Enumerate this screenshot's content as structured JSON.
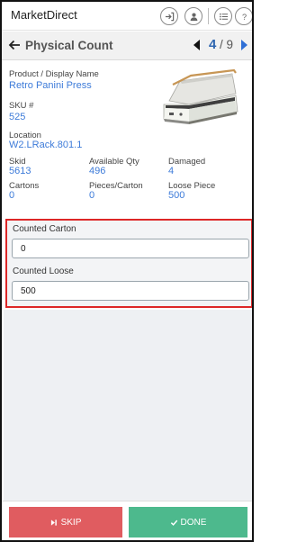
{
  "app": {
    "title": "MarketDirect"
  },
  "header": {
    "title": "Physical Count",
    "page_current": "4",
    "page_sep": "/ 9"
  },
  "details": {
    "product_label": "Product / Display Name",
    "product_value": "Retro Panini Press",
    "sku_label": "SKU #",
    "sku_value": "525",
    "location_label": "Location",
    "location_value": "W2.LRack.801.1",
    "skid_label": "Skid",
    "skid_value": "5613",
    "available_label": "Available Qty",
    "available_value": "496",
    "damaged_label": "Damaged",
    "damaged_value": "4",
    "cartons_label": "Cartons",
    "cartons_value": "0",
    "pieces_label": "Pieces/Carton",
    "pieces_value": "0",
    "loose_label": "Loose Piece",
    "loose_value": "500"
  },
  "count": {
    "carton_label": "Counted Carton",
    "carton_value": "0",
    "loose_label": "Counted Loose",
    "loose_value": "500"
  },
  "footer": {
    "skip_label": "SKIP",
    "done_label": "DONE"
  },
  "colors": {
    "accent": "#3d7bd9",
    "skip": "#e05c60",
    "done": "#4db98d",
    "highlight": "#dd2727"
  },
  "icons": [
    "login-icon",
    "user-icon",
    "list-icon",
    "help-icon",
    "back-arrow-icon",
    "prev-arrow-icon",
    "next-arrow-icon",
    "skip-icon",
    "check-icon"
  ]
}
